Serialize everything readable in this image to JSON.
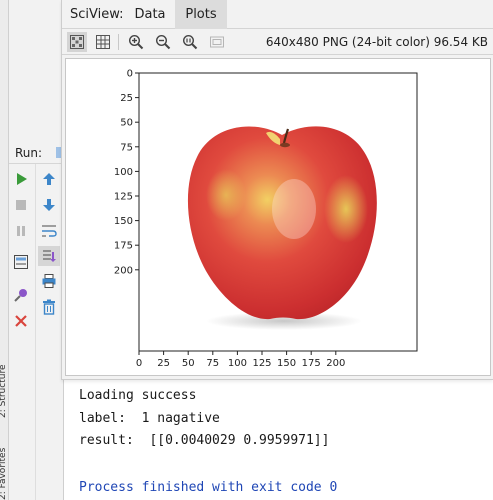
{
  "sciview": {
    "title": "SciView:",
    "tabs": [
      {
        "label": "Data",
        "active": false
      },
      {
        "label": "Plots",
        "active": true
      }
    ],
    "image_info": "640x480 PNG (24-bit color) 96.54 KB",
    "toolbar_icons": [
      "fit-view-icon",
      "grid-view-icon",
      "zoom-in-icon",
      "zoom-out-icon",
      "actual-size-icon",
      "fit-window-icon"
    ]
  },
  "plot": {
    "yticks": [
      "0",
      "25",
      "50",
      "75",
      "100",
      "125",
      "150",
      "175",
      "200"
    ],
    "xticks": [
      "0",
      "25",
      "50",
      "75",
      "100",
      "125",
      "150",
      "175",
      "200"
    ],
    "image_subject": "red apple"
  },
  "run": {
    "label": "Run:",
    "tools": [
      "run-icon",
      "stop-icon",
      "pause-icon",
      "layout-icon",
      "pin-icon",
      "close-icon"
    ],
    "tools_right": [
      "arrow-up-icon",
      "arrow-down-icon",
      "soft-wrap-icon",
      "scroll-end-icon",
      "print-icon",
      "trash-icon"
    ]
  },
  "left_strip": {
    "tabs": [
      "2: Structure",
      "2: Favorites"
    ]
  },
  "console": {
    "lines": [
      "Loading success",
      "label:  1 nagative",
      "result:  [[0.0040029 0.9959971]]",
      "",
      "Process finished with exit code 0"
    ]
  },
  "colors": {
    "exit_text": "#1f46b5",
    "run_green": "#3a9b3a",
    "close_red": "#d9453d",
    "icon_blue": "#3d86c9"
  }
}
